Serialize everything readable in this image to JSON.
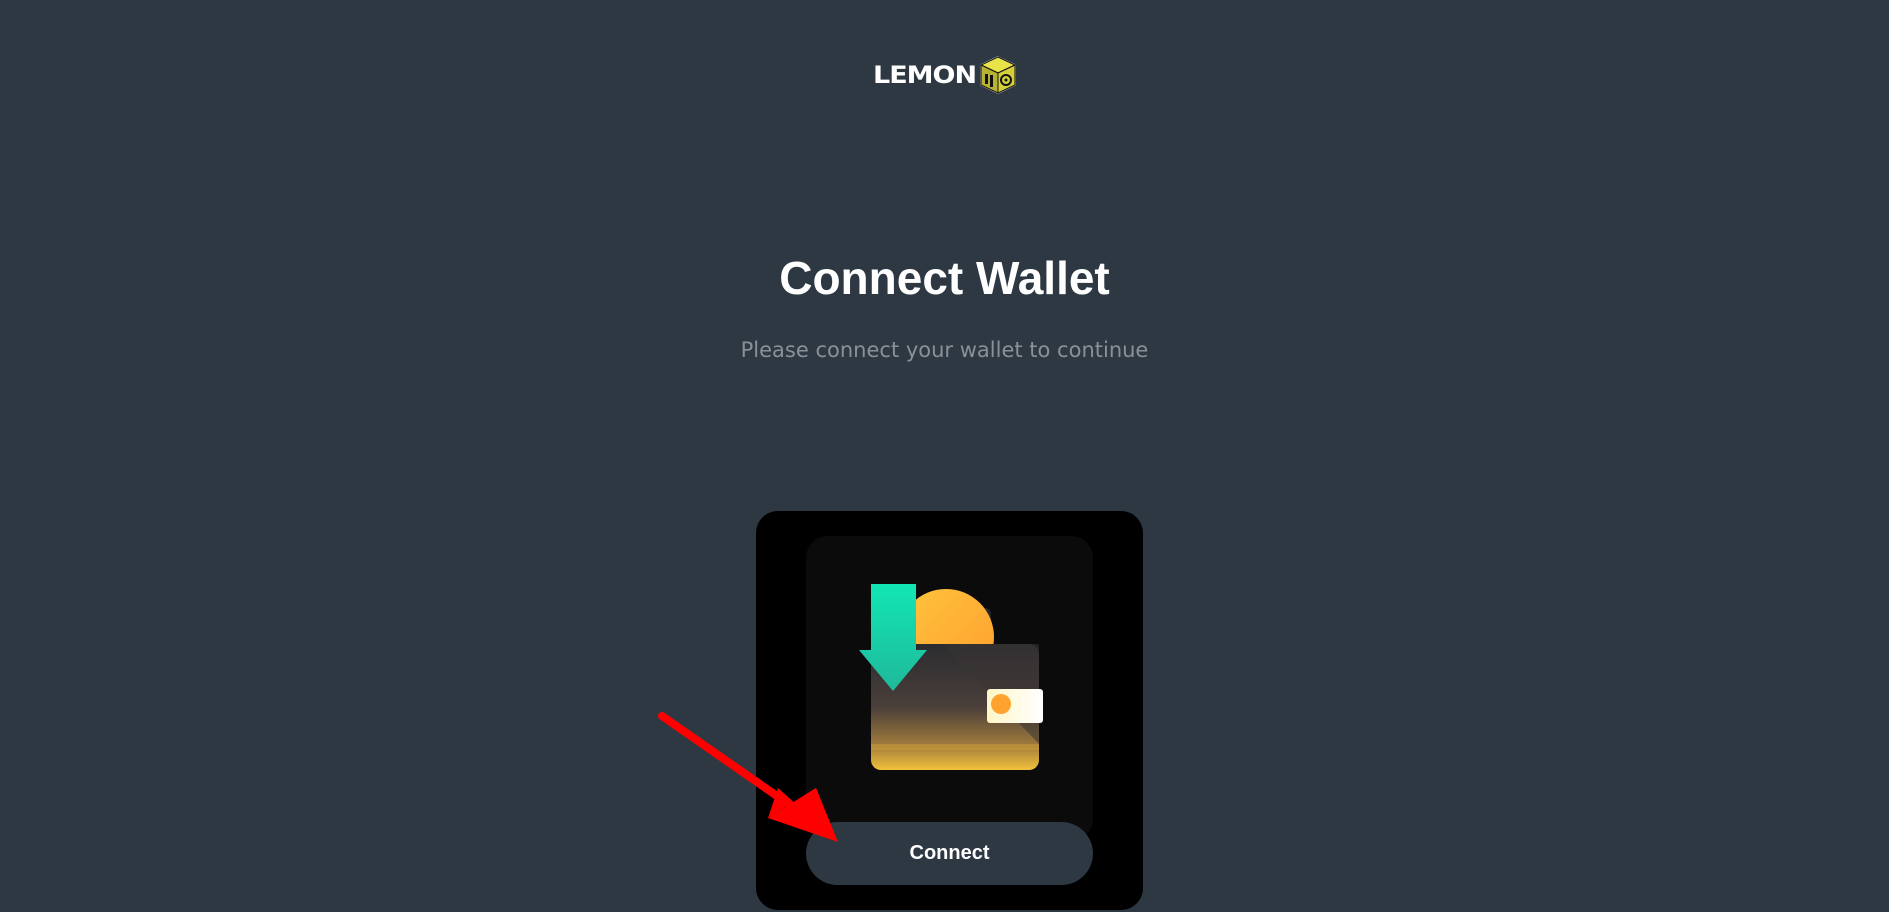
{
  "brand": {
    "logo_text": "LEMON",
    "logo_icon": "cube-icon"
  },
  "header": {
    "title": "Connect Wallet",
    "subtitle": "Please connect your wallet to continue"
  },
  "card": {
    "illustration": "wallet-download-icon",
    "connect_label": "Connect"
  },
  "annotation": {
    "pointer": "red-arrow-icon"
  },
  "colors": {
    "background": "#2e3843",
    "card": "#000000",
    "button": "#2e3843",
    "accent_green": "#17e3b0",
    "accent_orange": "#ffb43a",
    "arrow": "#ff0000"
  }
}
